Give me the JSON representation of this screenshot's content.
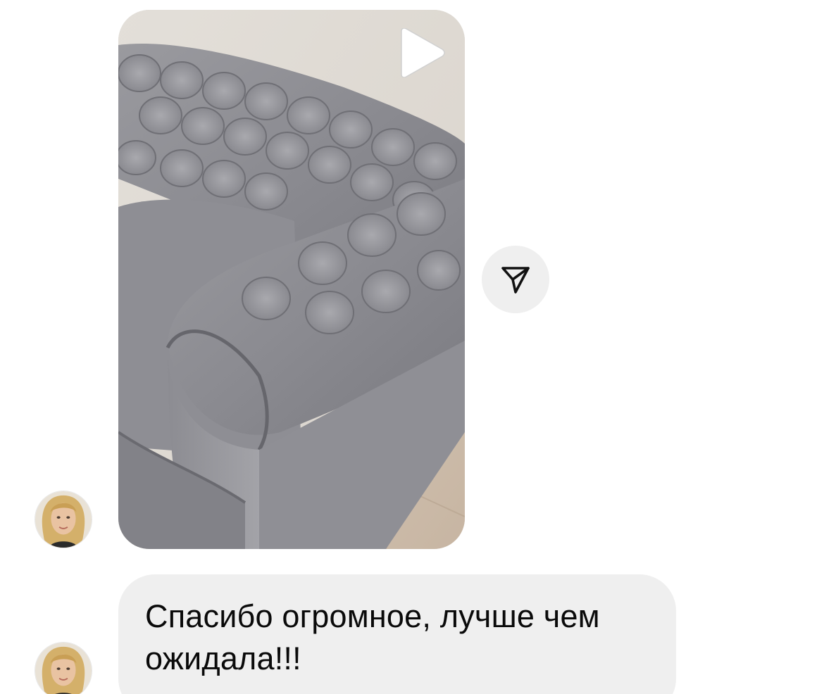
{
  "thread": {
    "messages": [
      {
        "type": "video",
        "sender": "other",
        "thumbnail_subject": "grey tufted velvet chesterfield sofa",
        "play_icon": "play-icon",
        "action_icon": "send-icon"
      },
      {
        "type": "text",
        "sender": "other",
        "text": "Спасибо огромное, лучше чем ожидала!!!"
      }
    ]
  },
  "colors": {
    "background": "#ffffff",
    "bubble_bg": "#efefef",
    "text": "#0a0a0a",
    "share_button_bg": "#efefef"
  }
}
